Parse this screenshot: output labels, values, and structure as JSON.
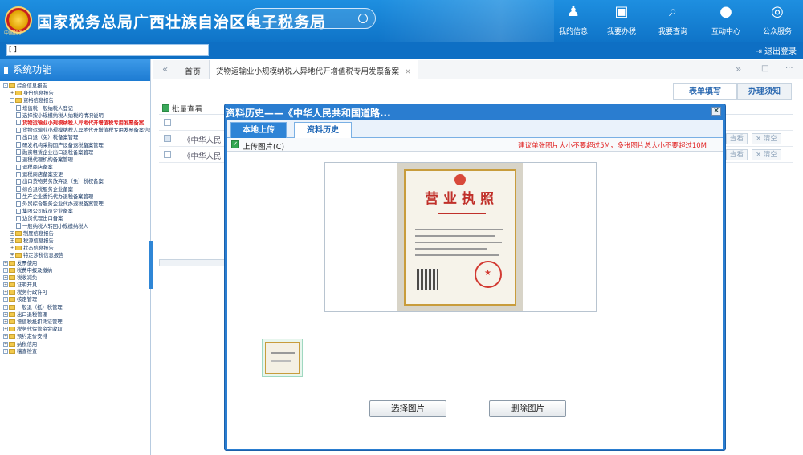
{
  "header": {
    "title": "国家税务总局广西壮族自治区电子税务局",
    "emblem_text": "中国税务",
    "nav": [
      {
        "label": "我的信息",
        "icon": "user-icon"
      },
      {
        "label": "我要办税",
        "icon": "monitor-icon"
      },
      {
        "label": "我要查询",
        "icon": "query-icon"
      },
      {
        "label": "互动中心",
        "icon": "chat-icon"
      },
      {
        "label": "公众服务",
        "icon": "service-icon"
      }
    ]
  },
  "address_strip": {
    "value": "[                                                                    ]",
    "logout": "退出登录"
  },
  "sidebar": {
    "title": "系统功能",
    "tree": [
      {
        "label": "综合信息报告",
        "kind": "folder",
        "depth": 0,
        "toggle": "-"
      },
      {
        "label": "身份信息报告",
        "kind": "folder",
        "depth": 1,
        "toggle": "+"
      },
      {
        "label": "资格信息报告",
        "kind": "folder",
        "depth": 1,
        "toggle": "-"
      },
      {
        "label": "增值税一般纳税人登记",
        "kind": "doc",
        "depth": 2
      },
      {
        "label": "选择按小规模纳税人纳税的情况说明",
        "kind": "doc",
        "depth": 2
      },
      {
        "label": "货物运输业小规模纳税人异地代开增值税专用发票备案",
        "kind": "doc",
        "depth": 2,
        "selected": true
      },
      {
        "label": "货物运输业小规模纳税人异地代开增值税专用发票备案信息确认",
        "kind": "doc",
        "depth": 2
      },
      {
        "label": "出口退（免）税备案管理",
        "kind": "doc",
        "depth": 2
      },
      {
        "label": "研发机构采购国产设备退税备案管理",
        "kind": "doc",
        "depth": 2
      },
      {
        "label": "融资租赁企业出口退税备案管理",
        "kind": "doc",
        "depth": 2
      },
      {
        "label": "退税代理机构备案管理",
        "kind": "doc",
        "depth": 2
      },
      {
        "label": "退税商店备案",
        "kind": "doc",
        "depth": 2
      },
      {
        "label": "退税商店备案变更",
        "kind": "doc",
        "depth": 2
      },
      {
        "label": "出口货物劳务放弃退（免）税权备案",
        "kind": "doc",
        "depth": 2
      },
      {
        "label": "综合退税服务企业备案",
        "kind": "doc",
        "depth": 2
      },
      {
        "label": "生产企业委托代办退税备案管理",
        "kind": "doc",
        "depth": 2
      },
      {
        "label": "外贸综合服务企业代办退税备案管理",
        "kind": "doc",
        "depth": 2
      },
      {
        "label": "集团公司成员企业备案",
        "kind": "doc",
        "depth": 2
      },
      {
        "label": "边贸代理出口备案",
        "kind": "doc",
        "depth": 2
      },
      {
        "label": "一般纳税人转回小规模纳税人",
        "kind": "doc",
        "depth": 2
      },
      {
        "label": "制度信息报告",
        "kind": "folder",
        "depth": 1,
        "toggle": "+"
      },
      {
        "label": "税源信息报告",
        "kind": "folder",
        "depth": 1,
        "toggle": "+"
      },
      {
        "label": "状态信息报告",
        "kind": "folder",
        "depth": 1,
        "toggle": "+"
      },
      {
        "label": "特定涉税信息报告",
        "kind": "folder",
        "depth": 1,
        "toggle": "+"
      },
      {
        "label": "发票使用",
        "kind": "folder",
        "depth": 0,
        "toggle": "+"
      },
      {
        "label": "税费申报及缴纳",
        "kind": "folder",
        "depth": 0,
        "toggle": "+"
      },
      {
        "label": "税收减免",
        "kind": "folder",
        "depth": 0,
        "toggle": "+"
      },
      {
        "label": "证明开具",
        "kind": "folder",
        "depth": 0,
        "toggle": "+"
      },
      {
        "label": "税务行政许可",
        "kind": "folder",
        "depth": 0,
        "toggle": "+"
      },
      {
        "label": "核定管理",
        "kind": "folder",
        "depth": 0,
        "toggle": "+"
      },
      {
        "label": "一般退（抵）税管理",
        "kind": "folder",
        "depth": 0,
        "toggle": "+"
      },
      {
        "label": "出口退税管理",
        "kind": "folder",
        "depth": 0,
        "toggle": "+"
      },
      {
        "label": "增值税抵扣凭证管理",
        "kind": "folder",
        "depth": 0,
        "toggle": "+"
      },
      {
        "label": "税务代保管资金收取",
        "kind": "folder",
        "depth": 0,
        "toggle": "+"
      },
      {
        "label": "预约定价安排",
        "kind": "folder",
        "depth": 0,
        "toggle": "+"
      },
      {
        "label": "纳税信用",
        "kind": "folder",
        "depth": 0,
        "toggle": "+"
      },
      {
        "label": "稽查检查",
        "kind": "folder",
        "depth": 0,
        "toggle": "+"
      }
    ]
  },
  "tabs": {
    "prev": "«",
    "home": "首页",
    "active": "货物运输业小规模纳税人异地代开增值税专用发票备案",
    "close": "×",
    "next": "»",
    "restore": "□",
    "more": "···"
  },
  "right_tabs": {
    "fill": "表单填写",
    "notice": "办理须知"
  },
  "background": {
    "batch_view": "批量查看",
    "rows": [
      {
        "text": "《中华人民"
      },
      {
        "text": "《中华人民"
      }
    ],
    "view_label": "查看",
    "clear_label": "× 清空"
  },
  "modal": {
    "title": "资料历史——《中华人民共和国道路...",
    "close": "×",
    "tab_local": "本地上传",
    "tab_history": "资料历史",
    "upload_label": "上传图片(C)",
    "hint": "建议单张图片大小不要超过5M，多张图片总大小不要超过10M",
    "preview_title": "营业执照",
    "choose_button": "选择图片",
    "delete_button": "删除图片"
  },
  "colors": {
    "header_blue": "#1a86da",
    "modal_blue": "#2a7dd0",
    "hint_red": "#e02222",
    "selected_red": "#e02020"
  }
}
